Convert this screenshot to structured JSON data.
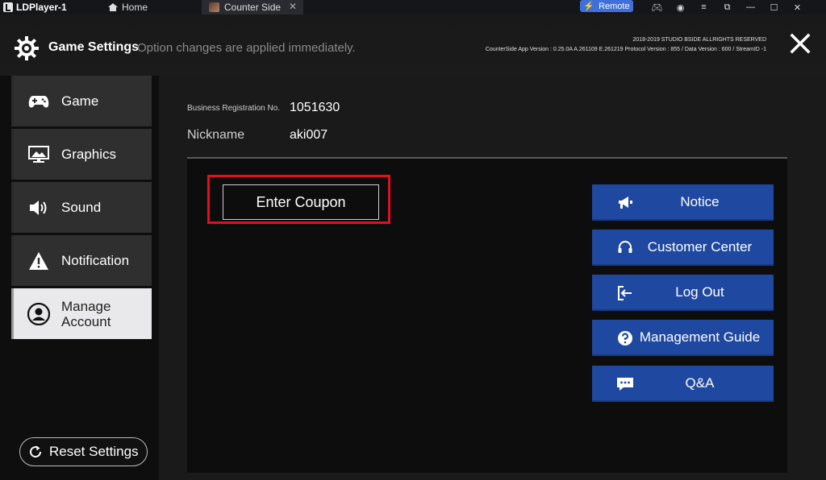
{
  "emulator": {
    "brand": "LDPlayer-1",
    "home_tab": "Home",
    "game_tab": "Counter Side",
    "remote_label": "Remote"
  },
  "header": {
    "title": "Game Settings",
    "subtitle": "Option changes are applied immediately.",
    "copyright_line1": "2018-2019 STUDIO BSIDE ALLRIGHTS RESERVED",
    "copyright_line2": "CounterSide App Version : 0.25.0A A.261109 E.261219 Protocol Version : 855 / Data Version : 600 / StreamID -1"
  },
  "sidebar": {
    "items": [
      {
        "label": "Game",
        "icon": "gamepad-icon",
        "active": false
      },
      {
        "label": "Graphics",
        "icon": "monitor-icon",
        "active": false
      },
      {
        "label": "Sound",
        "icon": "speaker-icon",
        "active": false
      },
      {
        "label": "Notification",
        "icon": "warning-icon",
        "active": false
      },
      {
        "label_line1": "Manage",
        "label_line2": "Account",
        "icon": "user-icon",
        "active": true
      }
    ],
    "reset_label": "Reset Settings"
  },
  "account": {
    "reg_label": "Business Registration No.",
    "reg_value": "1051630",
    "nick_label": "Nickname",
    "nick_value": "aki007"
  },
  "actions": {
    "coupon_label": "Enter Coupon",
    "buttons": [
      {
        "label": "Notice",
        "icon": "megaphone-icon"
      },
      {
        "label": "Customer Center",
        "icon": "headset-icon"
      },
      {
        "label": "Log Out",
        "icon": "logout-icon"
      },
      {
        "label": "Management Guide",
        "icon": "question-icon"
      },
      {
        "label": "Q&A",
        "icon": "chat-icon"
      }
    ]
  },
  "colors": {
    "button_blue": "#1f48a0",
    "highlight_red": "#e01020",
    "active_menu": "#e9e9eb",
    "remote_blue": "#3f6fd8"
  }
}
